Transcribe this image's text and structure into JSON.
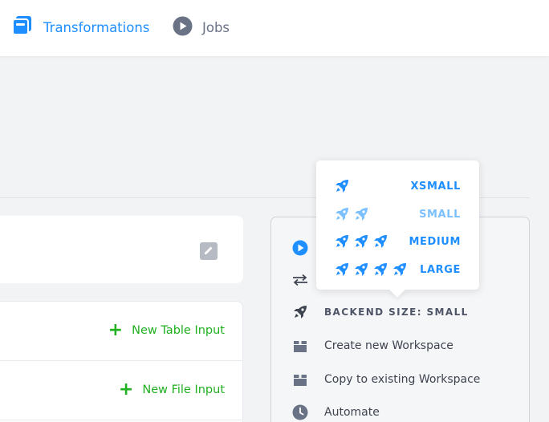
{
  "nav": {
    "transformations_label": "Transformations",
    "jobs_label": "Jobs"
  },
  "inputs": {
    "new_table_input": "New Table Input",
    "new_file_input": "New File Input"
  },
  "sidebar": {
    "backend_size_label": "BACKEND SIZE: SMALL",
    "create_workspace": "Create new Workspace",
    "copy_workspace": "Copy to existing Workspace",
    "automate": "Automate"
  },
  "backend_sizes": [
    {
      "label": "XSMALL",
      "rockets": 1,
      "selected": false
    },
    {
      "label": "SMALL",
      "rockets": 2,
      "selected": true
    },
    {
      "label": "MEDIUM",
      "rockets": 3,
      "selected": false
    },
    {
      "label": "LARGE",
      "rockets": 4,
      "selected": false
    }
  ],
  "colors": {
    "accent": "#1f8fff",
    "accent_light": "#7cc0ff",
    "add_green": "#20b020",
    "icon_gray": "#6a7285"
  }
}
